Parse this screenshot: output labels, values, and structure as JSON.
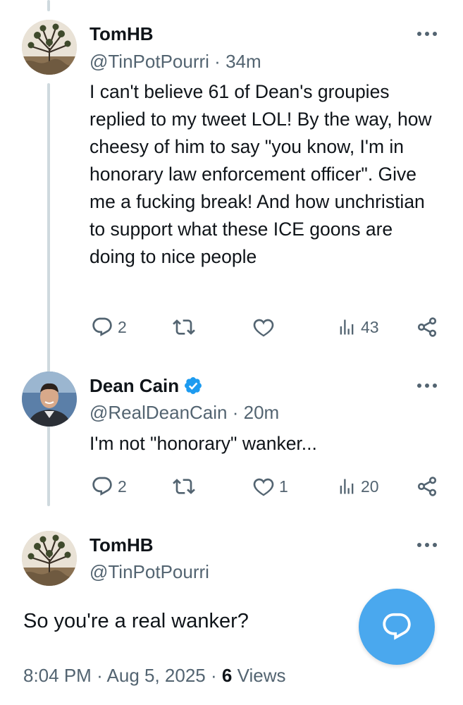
{
  "thread": [
    {
      "name": "TomHB",
      "handle": "@TinPotPourri",
      "separator": "·",
      "time": "34m",
      "avatar_icon": "joshua-tree-avatar",
      "text": "I can't believe 61 of Dean's groupies replied to my tweet LOL! By the way, how cheesy of him to say \"you know, I'm in honorary law enforcement officer\". Give me a fucking break! And how unchristian to support what these ICE goons are doing to nice people",
      "replies": "2",
      "reposts": "",
      "likes": "",
      "views": "43"
    },
    {
      "name": "Dean Cain",
      "verified": true,
      "handle": "@RealDeanCain",
      "separator": "·",
      "time": "20m",
      "avatar_icon": "profile-photo-avatar",
      "text": "I'm not \"honorary\" wanker...",
      "replies": "2",
      "reposts": "",
      "likes": "1",
      "views": "20"
    }
  ],
  "main_tweet": {
    "name": "TomHB",
    "handle": "@TinPotPourri",
    "avatar_icon": "joshua-tree-avatar",
    "text": "So you're a real wanker?",
    "time": "8:04 PM",
    "date": "Aug 5, 2025",
    "separator": "·",
    "views_count": "6",
    "views_label": "Views"
  },
  "fab": {
    "icon": "reply-bubble-icon"
  },
  "colors": {
    "text": "#0f1419",
    "secondary": "#536471",
    "thread_line": "#cfd9de",
    "verified": "#1d9bf0",
    "fab": "#4aa8ee"
  }
}
